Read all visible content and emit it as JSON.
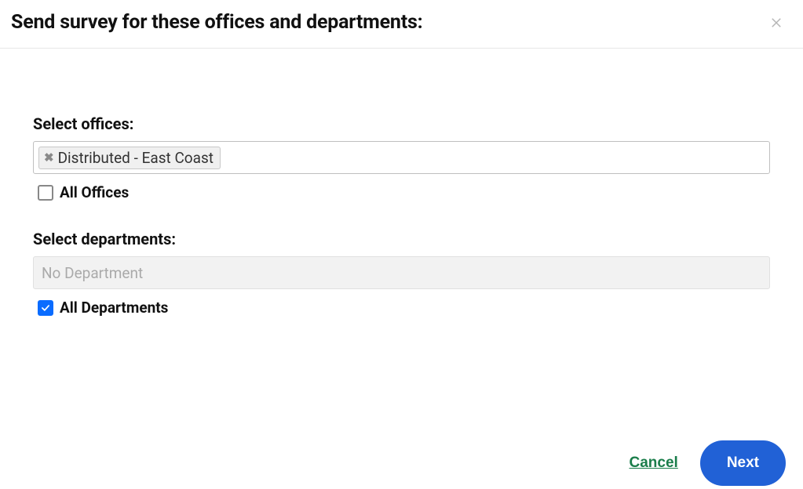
{
  "header": {
    "title": "Send survey for these offices and departments:"
  },
  "offices": {
    "label": "Select offices:",
    "tags": [
      {
        "label": "Distributed - East Coast"
      }
    ],
    "all_checkbox_label": "All Offices",
    "all_checked": false
  },
  "departments": {
    "label": "Select departments:",
    "placeholder": "No Department",
    "all_checkbox_label": "All Departments",
    "all_checked": true,
    "disabled": true
  },
  "footer": {
    "cancel_label": "Cancel",
    "next_label": "Next"
  }
}
